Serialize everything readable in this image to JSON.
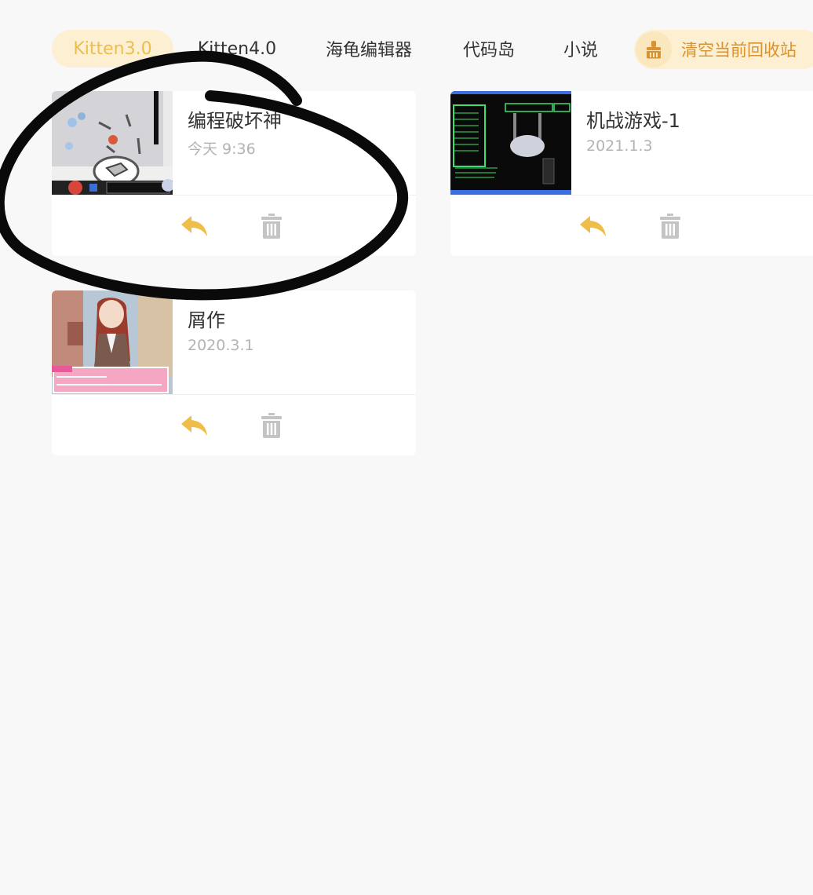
{
  "tabs": [
    {
      "label": "Kitten3.0",
      "active": true
    },
    {
      "label": "Kitten4.0",
      "active": false
    },
    {
      "label": "海龟编辑器",
      "active": false
    },
    {
      "label": "代码岛",
      "active": false
    },
    {
      "label": "小说",
      "active": false
    }
  ],
  "clear_button": {
    "label": "清空当前回收站",
    "icon": "broom-icon"
  },
  "projects": [
    {
      "title": "编程破坏神",
      "date": "今天 9:36"
    },
    {
      "title": "机战游戏-1",
      "date": "2021.1.3"
    },
    {
      "title": "屑作",
      "date": "2020.3.1"
    }
  ],
  "actions": {
    "restore_icon": "reply-arrow-icon",
    "delete_icon": "trash-icon"
  },
  "colors": {
    "accent": "#eebd4a",
    "accent_bg": "#fcefd2",
    "clear_text": "#d9922f",
    "title_text": "#333333",
    "date_text": "#b3b3b3",
    "trash_gray": "#c4c4c4",
    "background": "#f8f8f8"
  }
}
